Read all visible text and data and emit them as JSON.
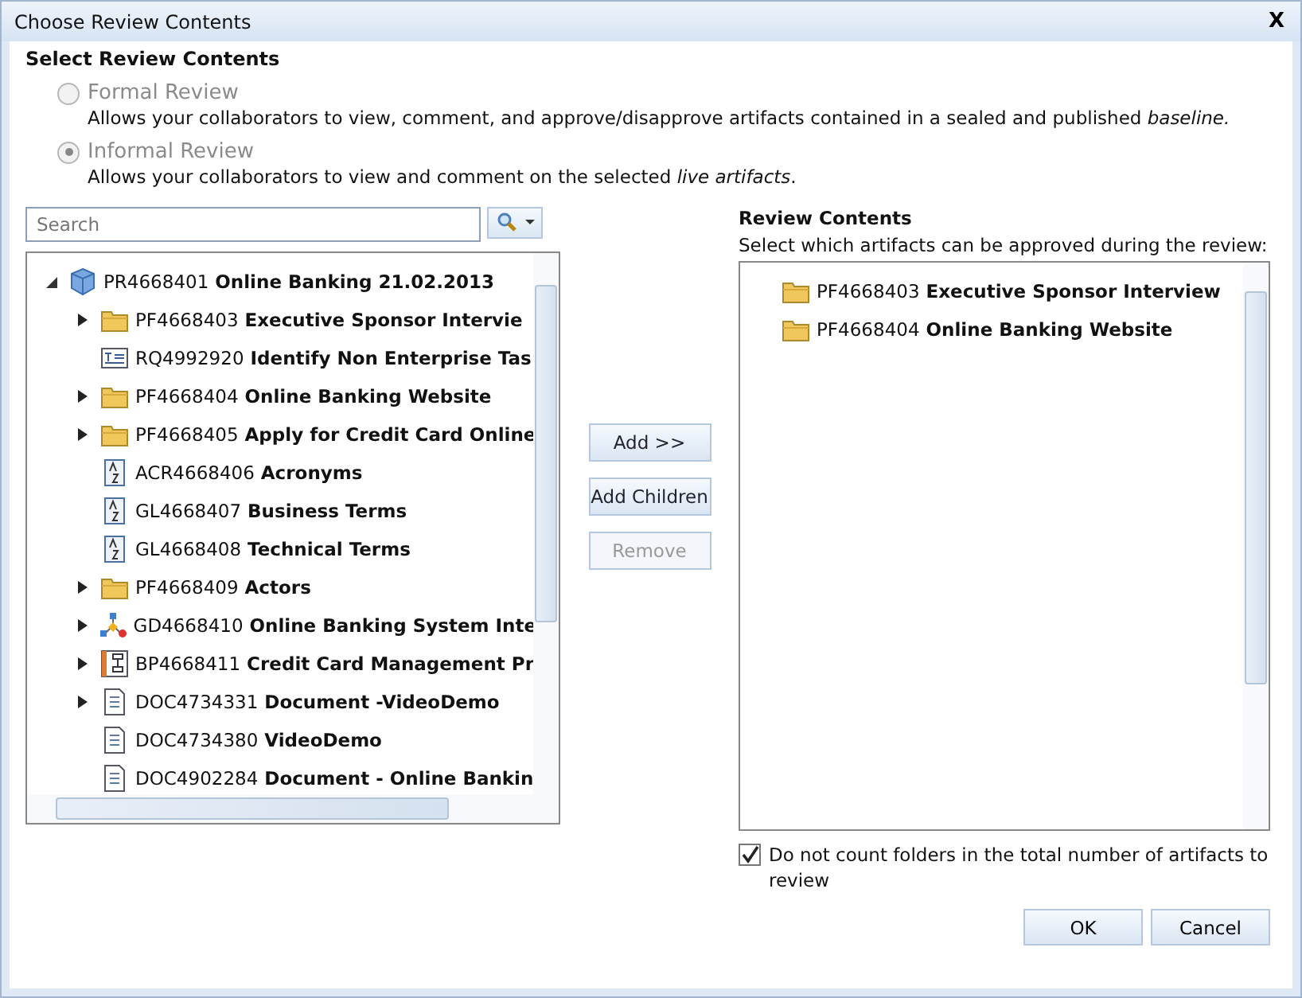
{
  "window": {
    "title": "Choose Review Contents",
    "close": "X"
  },
  "section_title": "Select Review Contents",
  "review_types": [
    {
      "label": "Formal Review",
      "description": "Allows your collaborators to view, comment, and approve/disapprove artifacts contained in a sealed and published *baseline.*",
      "selected": false,
      "disabled": true
    },
    {
      "label": "Informal Review",
      "description": "Allows your collaborators to view and comment on the selected *live artifacts*.",
      "selected": true,
      "disabled": true
    }
  ],
  "search": {
    "placeholder": "Search"
  },
  "tree": [
    {
      "id_text": "PR4668401",
      "name": "Online Banking 21.02.2013",
      "kind": "project",
      "has_children": true,
      "expanded": true,
      "children": [
        {
          "id_text": "PF4668403",
          "name": "Executive Sponsor Intervie",
          "kind": "folder",
          "has_children": true,
          "expanded": false
        },
        {
          "id_text": "RQ4992920",
          "name": "Identify Non Enterprise Tas",
          "kind": "requirement",
          "has_children": false
        },
        {
          "id_text": "PF4668404",
          "name": "Online Banking Website",
          "kind": "folder",
          "has_children": true,
          "expanded": false
        },
        {
          "id_text": "PF4668405",
          "name": "Apply for Credit Card Online",
          "kind": "folder",
          "has_children": true,
          "expanded": false
        },
        {
          "id_text": "ACR4668406",
          "name": "Acronyms",
          "kind": "glossary",
          "has_children": false
        },
        {
          "id_text": "GL4668407",
          "name": "Business Terms",
          "kind": "glossary",
          "has_children": false
        },
        {
          "id_text": "GL4668408",
          "name": "Technical Terms",
          "kind": "glossary",
          "has_children": false
        },
        {
          "id_text": "PF4668409",
          "name": "Actors",
          "kind": "folder",
          "has_children": true,
          "expanded": false
        },
        {
          "id_text": "GD4668410",
          "name": "Online Banking System Inte",
          "kind": "diagram",
          "has_children": true,
          "expanded": false
        },
        {
          "id_text": "BP4668411",
          "name": "Credit Card Management Pr",
          "kind": "process",
          "has_children": true,
          "expanded": false
        },
        {
          "id_text": "DOC4734331",
          "name": "Document -VideoDemo",
          "kind": "document",
          "has_children": true,
          "expanded": false
        },
        {
          "id_text": "DOC4734380",
          "name": "VideoDemo",
          "kind": "document",
          "has_children": false
        },
        {
          "id_text": "DOC4902284",
          "name": "Document - Online Bankin",
          "kind": "document",
          "has_children": false
        }
      ]
    }
  ],
  "actions": [
    {
      "label": "Add >>",
      "disabled": false
    },
    {
      "label": "Add Children",
      "disabled": false
    },
    {
      "label": "Remove",
      "disabled": true
    }
  ],
  "review_contents": {
    "title": "Review Contents",
    "subtitle": "Select which artifacts can be approved during the review:",
    "items": [
      {
        "id_text": "PF4668403",
        "name": "Executive Sponsor Interview",
        "kind": "folder"
      },
      {
        "id_text": "PF4668404",
        "name": "Online Banking Website",
        "kind": "folder"
      }
    ]
  },
  "exclude_folders": {
    "label": "Do not count folders in the total number of artifacts to review",
    "checked": true
  },
  "buttons": [
    "OK",
    "Cancel"
  ]
}
